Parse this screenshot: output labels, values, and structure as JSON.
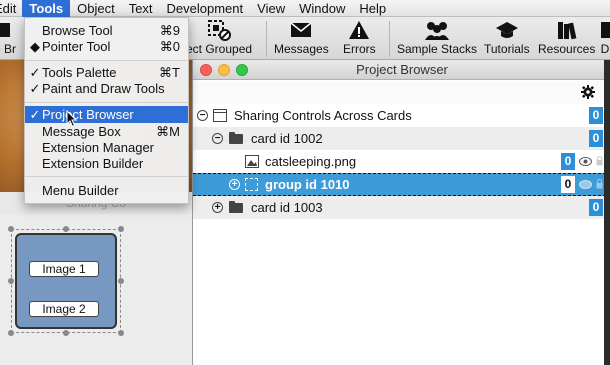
{
  "menubar": {
    "items": [
      {
        "label": "Edit"
      },
      {
        "label": "Tools"
      },
      {
        "label": "Object"
      },
      {
        "label": "Text"
      },
      {
        "label": "Development"
      },
      {
        "label": "View"
      },
      {
        "label": "Window"
      },
      {
        "label": "Help"
      }
    ]
  },
  "toolbar": {
    "browse_fragment": "e Br",
    "select_grouped": "ect Grouped",
    "messages": "Messages",
    "errors": "Errors",
    "sample_stacks": "Sample Stacks",
    "tutorials": "Tutorials",
    "resources": "Resources",
    "last_fragment": "D"
  },
  "tools_menu": {
    "items": [
      {
        "label": "Browse Tool",
        "shortcut": "⌘9",
        "mark": ""
      },
      {
        "label": "Pointer Tool",
        "shortcut": "⌘0",
        "mark": "◆"
      },
      {
        "label": "Tools Palette",
        "shortcut": "⌘T",
        "mark": "✓"
      },
      {
        "label": "Paint and Draw Tools",
        "shortcut": "",
        "mark": "✓"
      },
      {
        "label": "Project Browser",
        "shortcut": "",
        "mark": "✓"
      },
      {
        "label": "Message Box",
        "shortcut": "⌘M",
        "mark": ""
      },
      {
        "label": "Extension Manager",
        "shortcut": "",
        "mark": ""
      },
      {
        "label": "Extension Builder",
        "shortcut": "",
        "mark": ""
      },
      {
        "label": "Menu Builder",
        "shortcut": "",
        "mark": ""
      }
    ]
  },
  "stack_window": {
    "title": "Sharing Co",
    "image1": "Image 1",
    "image2": "Image 2"
  },
  "project_browser": {
    "title": "Project Browser",
    "rows": [
      {
        "label": "Sharing Controls Across Cards",
        "count": "0"
      },
      {
        "label": "card id 1002",
        "count": "0"
      },
      {
        "label": "catsleeping.png",
        "count": "0"
      },
      {
        "label": "group id 1010",
        "count": "0"
      },
      {
        "label": "card id 1003",
        "count": "0"
      }
    ]
  },
  "icons": {
    "gear": "gear-icon",
    "stack": "stack-icon",
    "folder": "folder-icon",
    "image": "image-icon",
    "eye": "eye-icon",
    "lock": "lock-icon"
  },
  "colors": {
    "accent": "#2d6fd6",
    "badge": "#2d8fd8",
    "selected_row": "#3d9bd8"
  }
}
